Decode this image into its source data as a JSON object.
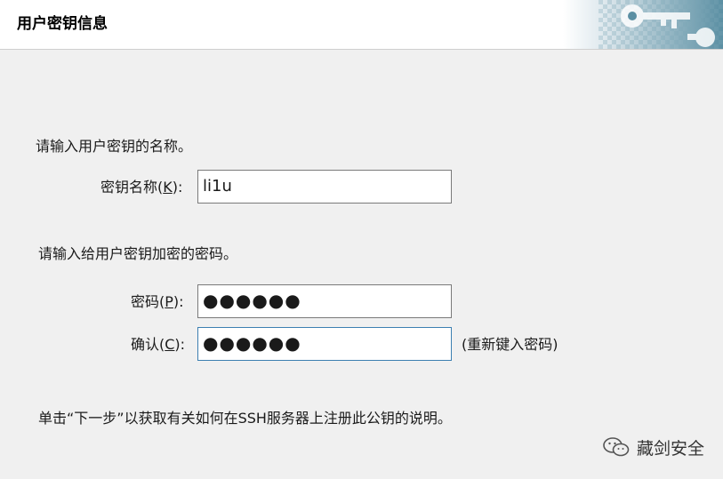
{
  "header": {
    "title": "用户密钥信息"
  },
  "name_section": {
    "prompt": "请输入用户密钥的名称。",
    "label_text": "密钥名称(",
    "label_accel": "K",
    "label_suffix": "):",
    "value": "li1u"
  },
  "password_section": {
    "prompt": "请输入给用户密钥加密的密码。",
    "password_label_text": "密码(",
    "password_label_accel": "P",
    "password_label_suffix": "):",
    "password_value": "●●●●●●",
    "confirm_label_text": "确认(",
    "confirm_label_accel": "C",
    "confirm_label_suffix": "):",
    "confirm_value": "●●●●●●",
    "confirm_hint": "(重新键入密码)"
  },
  "footer": {
    "instruction": "单击“下一步”以获取有关如何在SSH服务器上注册此公钥的说明。"
  },
  "watermark": {
    "text": "藏剑安全",
    "icon": "wechat-icon"
  },
  "colors": {
    "background": "#f0f0f0",
    "header_bg": "#ffffff",
    "focus_border": "#3c7fb1",
    "header_art": "#5b8fa3"
  }
}
